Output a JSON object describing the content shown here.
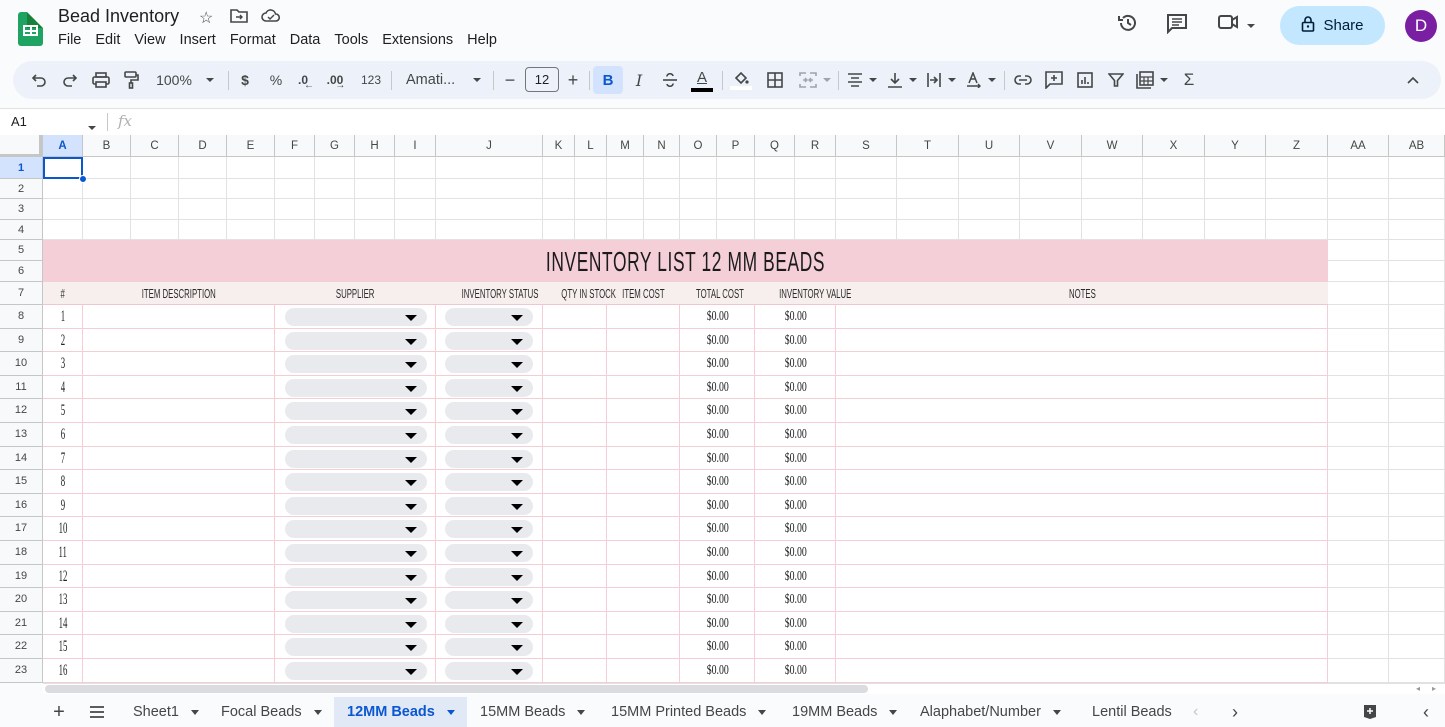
{
  "app": {
    "doc_title": "Bead Inventory",
    "menu": [
      "File",
      "Edit",
      "View",
      "Insert",
      "Format",
      "Data",
      "Tools",
      "Extensions",
      "Help"
    ],
    "share_label": "Share",
    "avatar_initial": "D",
    "accent_color": "#0b57d0",
    "share_bg": "#c2e7ff",
    "avatar_color": "#7b1fa2"
  },
  "toolbar": {
    "zoom": "100%",
    "currency": "$",
    "percent": "%",
    "decrease_decimal": ".0",
    "increase_decimal": ".00",
    "number_format": "123",
    "font": "Amati...",
    "font_size": "12",
    "bold": "B",
    "italic": "I",
    "text_color_label": "A"
  },
  "formula_bar": {
    "cell_ref": "A1",
    "fx": "fx",
    "value": ""
  },
  "columns": [
    "A",
    "B",
    "C",
    "D",
    "E",
    "F",
    "G",
    "H",
    "I",
    "J",
    "K",
    "L",
    "M",
    "N",
    "O",
    "P",
    "Q",
    "R",
    "S",
    "T",
    "U",
    "V",
    "W",
    "X",
    "Y",
    "Z",
    "AA",
    "AB"
  ],
  "rows": [
    "1",
    "2",
    "3",
    "4",
    "5",
    "6",
    "7",
    "8",
    "9",
    "10",
    "11",
    "12",
    "13",
    "14",
    "15",
    "16",
    "17",
    "18",
    "19",
    "20",
    "21",
    "22",
    "23"
  ],
  "selected_cell": "A1",
  "sheet": {
    "title": "INVENTORY LIST 12 MM BEADS",
    "banner_color": "#f4cfd7",
    "header_color": "#f6efed",
    "headers": {
      "num": "#",
      "item_description": "ITEM DESCRIPTION",
      "supplier": "SUPPLIER",
      "inventory_status": "INVENTORY STATUS",
      "qty_in_stock": "QTY IN STOCK",
      "item_cost": "ITEM COST",
      "total_cost": "TOTAL COST",
      "inventory_value": "INVENTORY VALUE",
      "notes": "NOTES"
    },
    "items": [
      {
        "num": "1",
        "supplier": "",
        "status": "",
        "total_cost": "$0.00",
        "inventory_value": "$0.00"
      },
      {
        "num": "2",
        "supplier": "",
        "status": "",
        "total_cost": "$0.00",
        "inventory_value": "$0.00"
      },
      {
        "num": "3",
        "supplier": "",
        "status": "",
        "total_cost": "$0.00",
        "inventory_value": "$0.00"
      },
      {
        "num": "4",
        "supplier": "",
        "status": "",
        "total_cost": "$0.00",
        "inventory_value": "$0.00"
      },
      {
        "num": "5",
        "supplier": "",
        "status": "",
        "total_cost": "$0.00",
        "inventory_value": "$0.00"
      },
      {
        "num": "6",
        "supplier": "",
        "status": "",
        "total_cost": "$0.00",
        "inventory_value": "$0.00"
      },
      {
        "num": "7",
        "supplier": "",
        "status": "",
        "total_cost": "$0.00",
        "inventory_value": "$0.00"
      },
      {
        "num": "8",
        "supplier": "",
        "status": "",
        "total_cost": "$0.00",
        "inventory_value": "$0.00"
      },
      {
        "num": "9",
        "supplier": "",
        "status": "",
        "total_cost": "$0.00",
        "inventory_value": "$0.00"
      },
      {
        "num": "10",
        "supplier": "",
        "status": "",
        "total_cost": "$0.00",
        "inventory_value": "$0.00"
      },
      {
        "num": "11",
        "supplier": "",
        "status": "",
        "total_cost": "$0.00",
        "inventory_value": "$0.00"
      },
      {
        "num": "12",
        "supplier": "",
        "status": "",
        "total_cost": "$0.00",
        "inventory_value": "$0.00"
      },
      {
        "num": "13",
        "supplier": "",
        "status": "",
        "total_cost": "$0.00",
        "inventory_value": "$0.00"
      },
      {
        "num": "14",
        "supplier": "",
        "status": "",
        "total_cost": "$0.00",
        "inventory_value": "$0.00"
      },
      {
        "num": "15",
        "supplier": "",
        "status": "",
        "total_cost": "$0.00",
        "inventory_value": "$0.00"
      },
      {
        "num": "16",
        "supplier": "",
        "status": "",
        "total_cost": "$0.00",
        "inventory_value": "$0.00"
      }
    ]
  },
  "tabs": [
    {
      "label": "Sheet1",
      "active": false
    },
    {
      "label": "Focal Beads",
      "active": false
    },
    {
      "label": "12MM Beads",
      "active": true
    },
    {
      "label": "15MM Beads",
      "active": false
    },
    {
      "label": "15MM Printed Beads",
      "active": false
    },
    {
      "label": "19MM Beads",
      "active": false
    },
    {
      "label": "Alaphabet/Number",
      "active": false
    },
    {
      "label": "Lentil Beads",
      "active": false
    }
  ]
}
